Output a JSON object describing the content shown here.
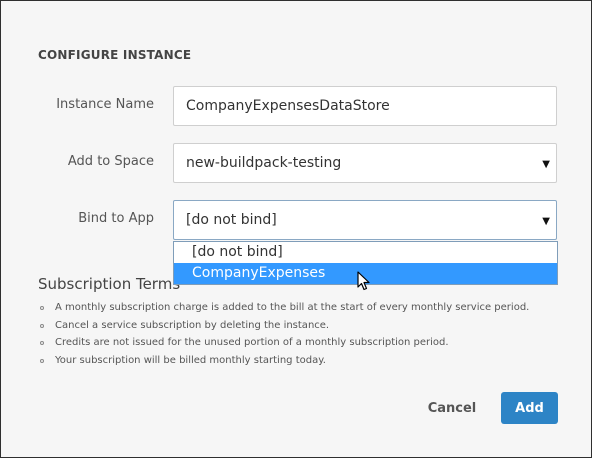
{
  "dialog": {
    "section_title": "CONFIGURE INSTANCE",
    "instance_name": {
      "label": "Instance Name",
      "value": "CompanyExpensesDataStore"
    },
    "add_to_space": {
      "label": "Add to Space",
      "selected": "new-buildpack-testing"
    },
    "bind_to_app": {
      "label": "Bind to App",
      "selected": "[do not bind]",
      "options": [
        "[do not bind]",
        "CompanyExpenses"
      ],
      "highlighted_index": 1
    },
    "subscription": {
      "title": "Subscription Terms",
      "terms": [
        "A monthly subscription charge is added to the bill at the start of every monthly service period.",
        "Cancel a service subscription by deleting the instance.",
        "Credits are not issued for the unused portion of a monthly subscription period.",
        "Your subscription will be billed monthly starting today."
      ]
    },
    "buttons": {
      "cancel": "Cancel",
      "add": "Add"
    }
  },
  "icons": {
    "select_caret": "▼",
    "cursor": "mouse-pointer-icon"
  },
  "colors": {
    "accent": "#2d84c6",
    "highlight": "#3399ff",
    "background": "#f6f6f6"
  }
}
